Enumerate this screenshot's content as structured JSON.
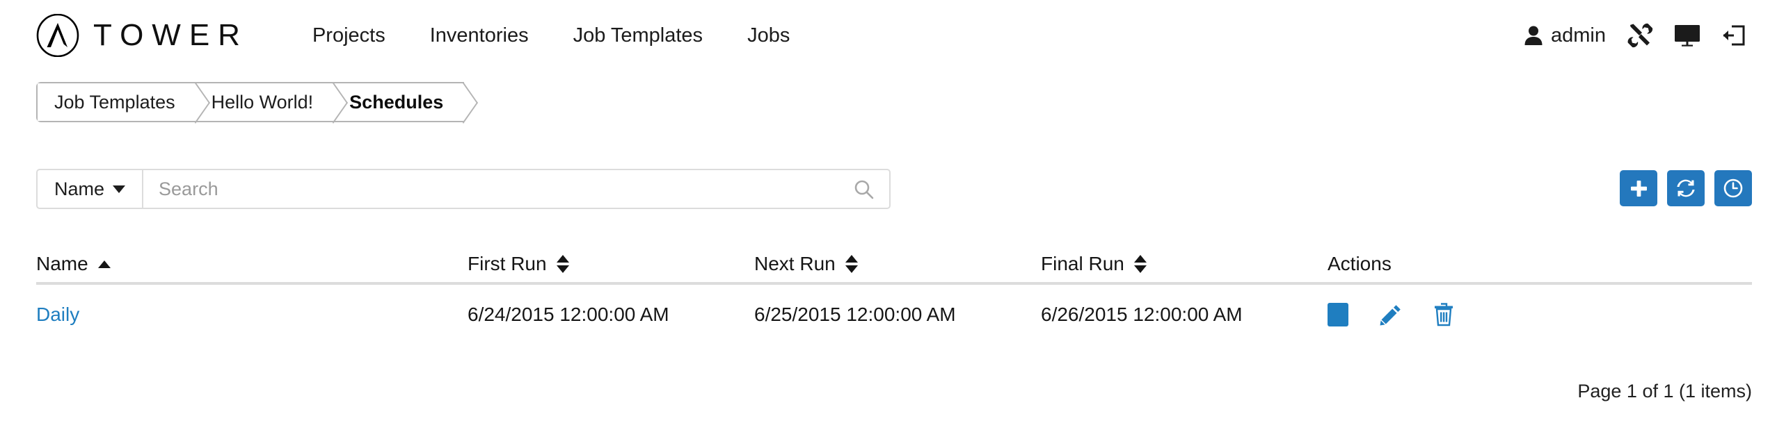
{
  "brand": {
    "name": "TOWER",
    "logo_icon": "ansible-a-logo-icon"
  },
  "nav": {
    "items": [
      {
        "label": "Projects"
      },
      {
        "label": "Inventories"
      },
      {
        "label": "Job Templates"
      },
      {
        "label": "Jobs"
      }
    ]
  },
  "account": {
    "user_icon": "user-icon",
    "username": "admin",
    "icons": [
      {
        "name": "tools-icon"
      },
      {
        "name": "monitor-icon"
      },
      {
        "name": "logout-icon"
      }
    ]
  },
  "breadcrumb": {
    "items": [
      {
        "label": "Job Templates",
        "active": false
      },
      {
        "label": "Hello World!",
        "active": false
      },
      {
        "label": "Schedules",
        "active": true
      }
    ]
  },
  "search": {
    "key_label": "Name",
    "key_caret_icon": "chevron-down-icon",
    "placeholder": "Search",
    "value": "",
    "search_icon": "search-icon"
  },
  "toolbar": {
    "accent_color": "#2478bd",
    "buttons": [
      {
        "name": "add-schedule-button",
        "icon": "plus-icon"
      },
      {
        "name": "refresh-button",
        "icon": "refresh-icon"
      },
      {
        "name": "schedule-toggle-button",
        "icon": "clock-icon"
      }
    ]
  },
  "table": {
    "columns": [
      {
        "key": "name",
        "label": "Name",
        "sortable": true,
        "sort": "asc"
      },
      {
        "key": "first",
        "label": "First Run",
        "sortable": true,
        "sort": "none"
      },
      {
        "key": "next",
        "label": "Next Run",
        "sortable": true,
        "sort": "none"
      },
      {
        "key": "final",
        "label": "Final Run",
        "sortable": true,
        "sort": "none"
      },
      {
        "key": "actions",
        "label": "Actions",
        "sortable": false,
        "sort": "none"
      }
    ],
    "rows": [
      {
        "name": "Daily",
        "name_color": "#1f7ec0",
        "first": "6/24/2015 12:00:00 AM",
        "next": "6/25/2015 12:00:00 AM",
        "final": "6/26/2015 12:00:00 AM",
        "actions": [
          {
            "name": "toggle-schedule-action",
            "icon": "stop-block-icon"
          },
          {
            "name": "edit-schedule-action",
            "icon": "pencil-icon"
          },
          {
            "name": "delete-schedule-action",
            "icon": "trash-icon"
          }
        ]
      }
    ]
  },
  "pagination": {
    "text": "Page 1 of 1 (1 items)"
  }
}
